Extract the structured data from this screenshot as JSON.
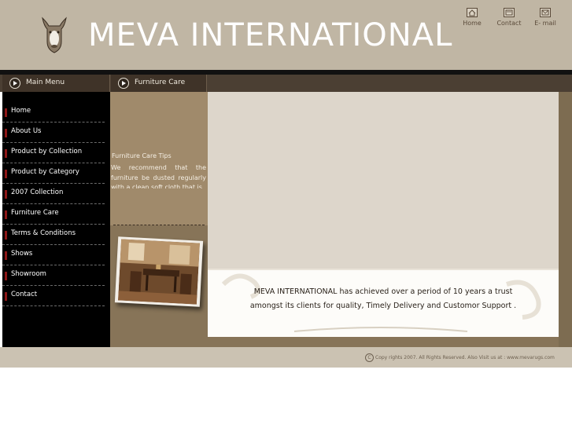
{
  "brand": {
    "title": "MEVA INTERNATIONAL"
  },
  "top_nav": {
    "home": "Home",
    "contact": "Contact",
    "email": "E- mail"
  },
  "section_headers": {
    "main_menu": "Main Menu",
    "furniture_care": "Furniture Care"
  },
  "menu": {
    "items": [
      {
        "label": "Home"
      },
      {
        "label": "About Us"
      },
      {
        "label": "Product by Collection"
      },
      {
        "label": "Product by Category"
      },
      {
        "label": "2007 Collection"
      },
      {
        "label": "Furniture Care"
      },
      {
        "label": "Terms & Conditions"
      },
      {
        "label": "Shows"
      },
      {
        "label": "Showroom"
      },
      {
        "label": "Contact"
      }
    ]
  },
  "tips": {
    "title": "Furniture Care Tips",
    "text": "We recommend that the furniture be dusted regularly with a clean soft cloth that is"
  },
  "banner": {
    "line1": "MEVA INTERNATIONAL has achieved over a period of 10 years a trust",
    "line2": "amongst its clients for quality,  Timely Delivery and Customor Support ."
  },
  "footer": {
    "copy_symbol": "C",
    "text": "Copy rights  2007. All Rights Reserved.  Also Visit us at : www.mevarugs.com"
  },
  "colors": {
    "header_bg": "#c0b6a4",
    "menu_bg": "#000000",
    "menu_bullet": "#8d1717",
    "content_bg": "#ddd6cb",
    "sidebar_brown": "#877458"
  },
  "icons": {
    "logo": "bull-head-emblem",
    "home": "house-icon",
    "contact": "card-icon",
    "email": "letter-icon",
    "section": "arrow-circle-icon"
  }
}
